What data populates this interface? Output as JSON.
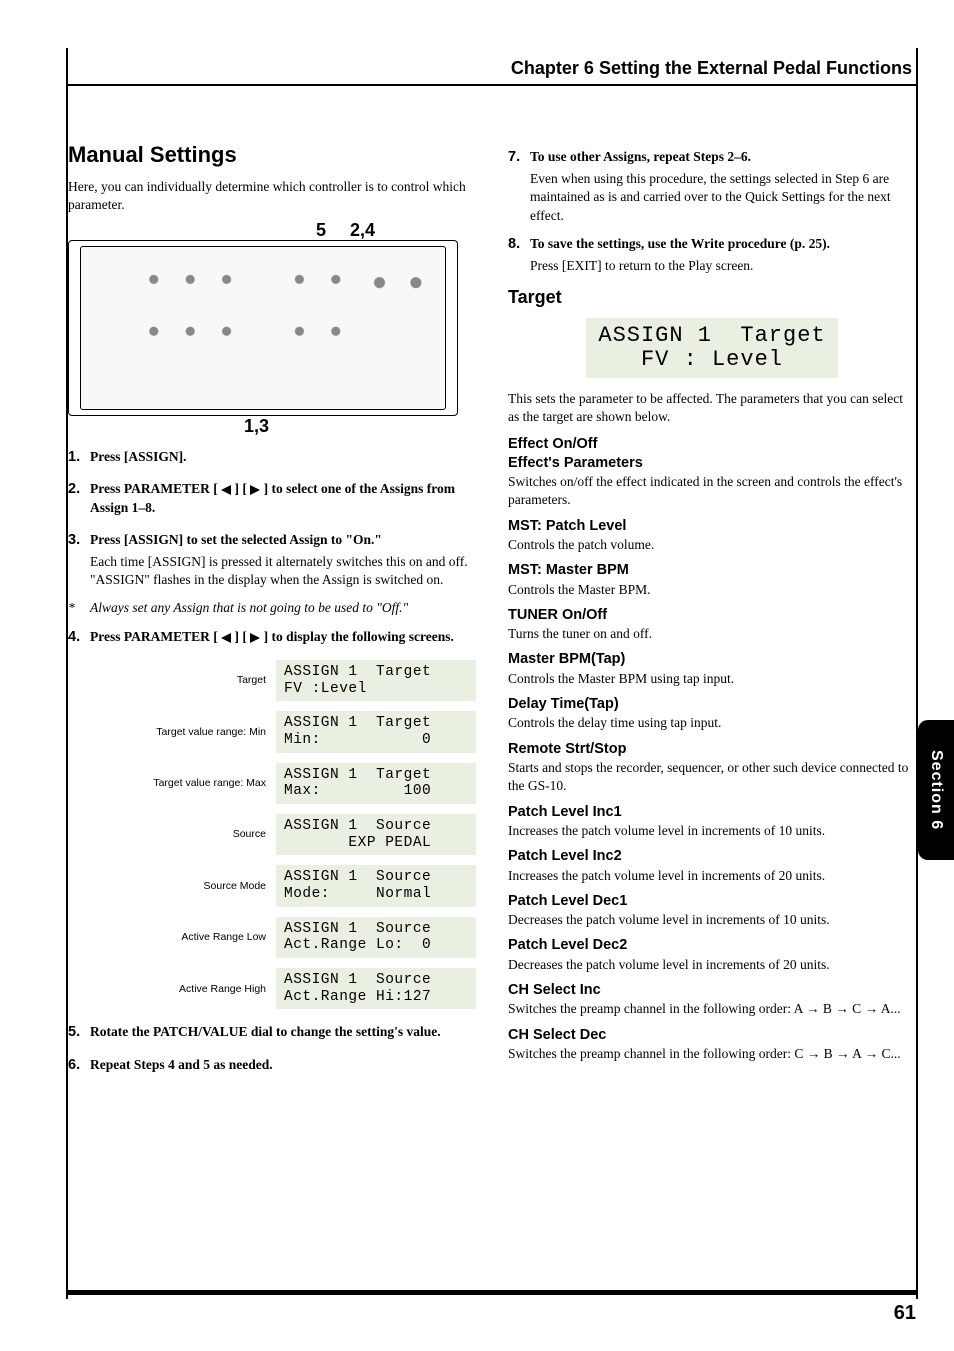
{
  "chapter": {
    "title": "Chapter 6 Setting the External Pedal Functions"
  },
  "left": {
    "heading": "Manual Settings",
    "intro": "Here, you can individually determine which controller is to control which parameter.",
    "callouts": {
      "top_left": "5",
      "top_right": "2,4",
      "bottom": "1,3"
    },
    "steps": [
      {
        "n": "1.",
        "lead": "Press [ASSIGN]."
      },
      {
        "n": "2.",
        "lead_pre": "Press PARAMETER [",
        "lead_post": "] to select one of the Assigns from Assign 1–8."
      },
      {
        "n": "3.",
        "lead": "Press [ASSIGN] to set the selected Assign to \"On.\"",
        "body": "Each time [ASSIGN] is pressed it alternately switches this on and off. \"ASSIGN\" flashes in the display when the Assign is switched on."
      },
      {
        "n": "4.",
        "lead_pre": "Press PARAMETER [",
        "lead_post": "] to display the following screens."
      },
      {
        "n": "5.",
        "lead": "Rotate the PATCH/VALUE dial to change the setting's value."
      },
      {
        "n": "6.",
        "lead": "Repeat Steps 4 and 5 as needed."
      }
    ],
    "note": "Always set any Assign that is not going to be used to \"Off.\"",
    "screens": [
      {
        "label": "Target",
        "line1": "ASSIGN 1  Target",
        "line2": "FV :Level"
      },
      {
        "label": "Target value range: Min",
        "line1": "ASSIGN 1  Target",
        "line2": "Min:           0"
      },
      {
        "label": "Target value range: Max",
        "line1": "ASSIGN 1  Target",
        "line2": "Max:         100"
      },
      {
        "label": "Source",
        "line1": "ASSIGN 1  Source",
        "line2": "       EXP PEDAL"
      },
      {
        "label": "Source Mode",
        "line1": "ASSIGN 1  Source",
        "line2": "Mode:     Normal"
      },
      {
        "label": "Active Range Low",
        "line1": "ASSIGN 1  Source",
        "line2": "Act.Range Lo:  0"
      },
      {
        "label": "Active Range  High",
        "line1": "ASSIGN 1  Source",
        "line2": "Act.Range Hi:127"
      }
    ]
  },
  "right": {
    "steps": [
      {
        "n": "7.",
        "lead": "To use other Assigns, repeat Steps 2–6.",
        "body": "Even when using this procedure, the settings selected in Step 6 are maintained as is and carried over to the Quick Settings for the next effect."
      },
      {
        "n": "8.",
        "lead": "To save the settings, use the Write procedure (p. 25).",
        "body": "Press [EXIT] to return to the Play screen."
      }
    ],
    "target_heading": "Target",
    "target_lcd": {
      "line1": "ASSIGN 1  Target",
      "line2": "FV : Level"
    },
    "target_intro": "This sets the parameter to be affected. The parameters that you can select as the target are shown below.",
    "effect_h1": "Effect On/Off",
    "effect_h2": "Effect's Parameters",
    "effect_body": "Switches on/off the effect indicated in the screen and controls the effect's parameters.",
    "items": [
      {
        "h": "MST: Patch Level",
        "b": "Controls the patch volume."
      },
      {
        "h": "MST: Master BPM",
        "b": "Controls the Master BPM."
      },
      {
        "h": "TUNER On/Off",
        "b": "Turns the tuner on and off."
      },
      {
        "h": "Master BPM(Tap)",
        "b": "Controls the Master BPM using tap input."
      },
      {
        "h": "Delay Time(Tap)",
        "b": "Controls the delay time using tap input."
      },
      {
        "h": "Remote Strt/Stop",
        "b": "Starts and stops the recorder, sequencer, or other such device connected to the GS-10."
      },
      {
        "h": "Patch Level Inc1",
        "b": "Increases the patch volume level in increments of 10 units."
      },
      {
        "h": "Patch Level Inc2",
        "b": "Increases the patch volume level in increments of 20 units."
      },
      {
        "h": "Patch Level Dec1",
        "b": "Decreases the patch volume level in increments of 10 units."
      },
      {
        "h": "Patch Level Dec2",
        "b": "Decreases the patch volume level in increments of 20 units."
      },
      {
        "h": "CH Select Inc",
        "b": "Switches the preamp channel in the following order: A → B → C → A..."
      },
      {
        "h": "CH Select Dec",
        "b": "Switches the preamp channel in the following order: C → B → A → C..."
      }
    ]
  },
  "side_tab": "Section 6",
  "page_number": "61"
}
